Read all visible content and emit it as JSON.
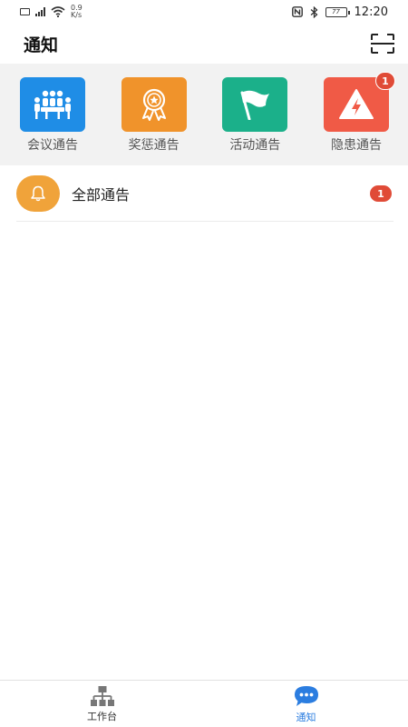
{
  "status_bar": {
    "net_speed_value": "0.9",
    "net_speed_unit": "K/s",
    "signal_type": "4G",
    "battery_label": "77",
    "time": "12:20"
  },
  "header": {
    "title": "通知",
    "scan_icon": "scan-icon"
  },
  "categories": [
    {
      "label": "会议通告",
      "icon": "meeting-icon",
      "color": "#1f8de6",
      "badge": ""
    },
    {
      "label": "奖惩通告",
      "icon": "award-medal-icon",
      "color": "#f0932b",
      "badge": ""
    },
    {
      "label": "活动通告",
      "icon": "flag-icon",
      "color": "#1bb08a",
      "badge": ""
    },
    {
      "label": "隐患通告",
      "icon": "hazard-warning-icon",
      "color": "#f05a46",
      "badge": "1"
    }
  ],
  "notices": [
    {
      "label": "全部通告",
      "icon": "bell-icon",
      "color": "#f0a33a",
      "badge": "1"
    }
  ],
  "bottom_nav": [
    {
      "label": "工作台",
      "icon": "workbench-icon",
      "active": false
    },
    {
      "label": "通知",
      "icon": "chat-bubble-icon",
      "active": true,
      "accent": "#2b7de0"
    }
  ]
}
